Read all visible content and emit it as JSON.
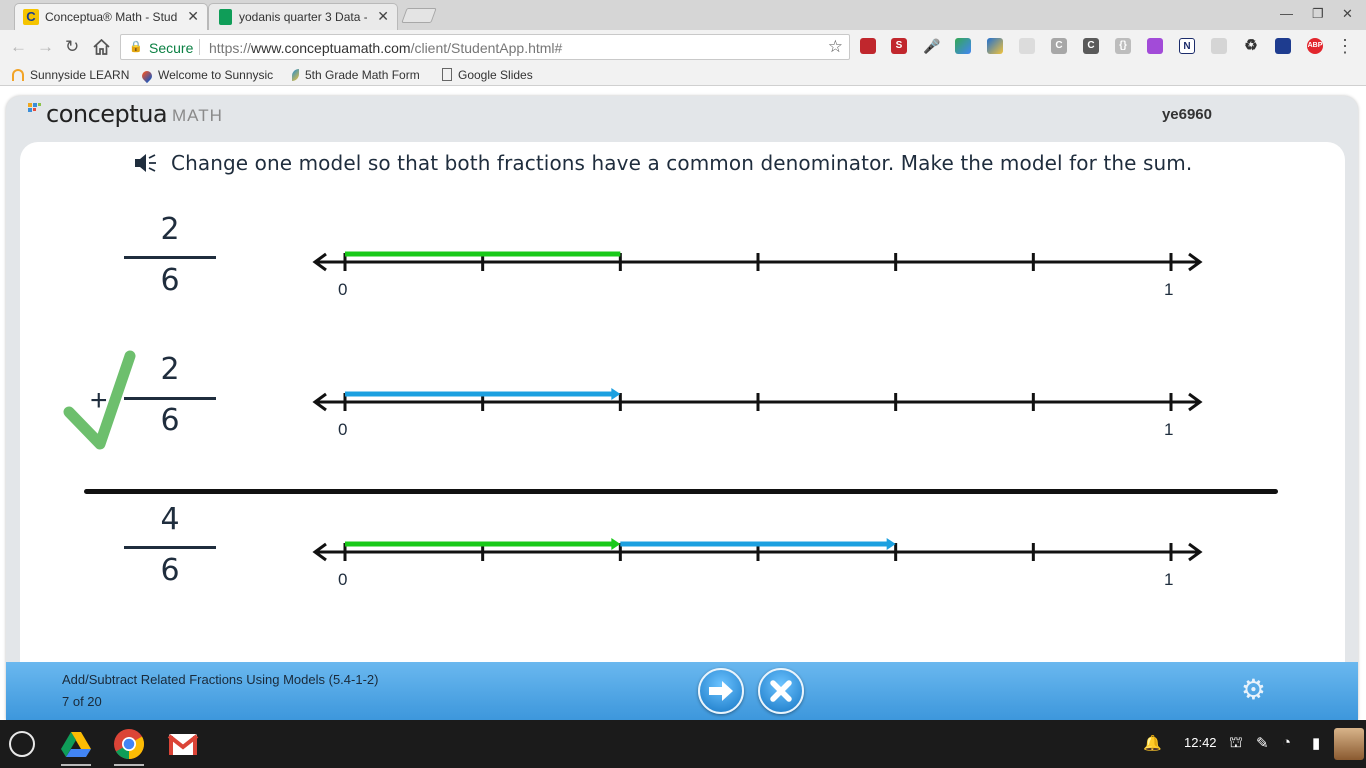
{
  "browser": {
    "tabs": [
      {
        "title": "Conceptua® Math - Stud",
        "active": true,
        "icon": "conceptua-c-icon"
      },
      {
        "title": "yodanis quarter 3 Data -",
        "active": false,
        "icon": "sheets-icon"
      }
    ],
    "url_secure_label": "Secure",
    "url_scheme": "https://",
    "url_host": "www.conceptuamath.com",
    "url_path": "/client/StudentApp.html#",
    "bookmarks": [
      {
        "label": "Sunnyside LEARN",
        "icon": "sunnyside-icon"
      },
      {
        "label": "Welcome to Sunnysic",
        "icon": "drop-icon"
      },
      {
        "label": "5th Grade Math Form",
        "icon": "feather-icon"
      },
      {
        "label": "Google Slides",
        "icon": "page-icon"
      }
    ],
    "extensions": [
      "book-icon",
      "s-icon",
      "mic-icon",
      "puzzle-multi-icon",
      "pen-icon",
      "camera-icon",
      "c-grey-icon",
      "c-dark-icon",
      "braces-icon",
      "puzzle-purple-icon",
      "n-icon",
      "shield-icon",
      "recycle-icon",
      "block-icon",
      "adblock-icon"
    ],
    "extension_abp_label": "ABP"
  },
  "app": {
    "brand": "conceptua",
    "brand_suffix": "MATH",
    "username": "ye6960",
    "prompt": "Change one model so that both fractions have a common denominator. Make the model for the sum.",
    "problem": {
      "first": {
        "numerator": "2",
        "denominator": "6"
      },
      "second": {
        "operator": "+",
        "numerator": "2",
        "denominator": "6"
      },
      "sum": {
        "numerator": "4",
        "denominator": "6"
      }
    },
    "number_lines": [
      {
        "label_start": "0",
        "label_end": "1",
        "ticks": 6,
        "segments": [
          {
            "from": 0,
            "to": 2,
            "color": "#19c919",
            "arrow": false
          }
        ]
      },
      {
        "label_start": "0",
        "label_end": "1",
        "ticks": 6,
        "segments": [
          {
            "from": 0,
            "to": 2,
            "color": "#1ca0e0",
            "arrow": true
          }
        ]
      },
      {
        "label_start": "0",
        "label_end": "1",
        "ticks": 6,
        "segments": [
          {
            "from": 0,
            "to": 2,
            "color": "#19c919",
            "arrow": true
          },
          {
            "from": 2,
            "to": 4,
            "color": "#1ca0e0",
            "arrow": true
          }
        ]
      }
    ],
    "checkmark_color": "#6dbf6d",
    "footer": {
      "lesson": "Add/Subtract Related Fractions Using Models (5.4-1-2)",
      "progress": "7 of 20"
    }
  },
  "shelf": {
    "apps": [
      "drive-icon",
      "chrome-icon",
      "gmail-icon"
    ],
    "time": "12:42"
  }
}
